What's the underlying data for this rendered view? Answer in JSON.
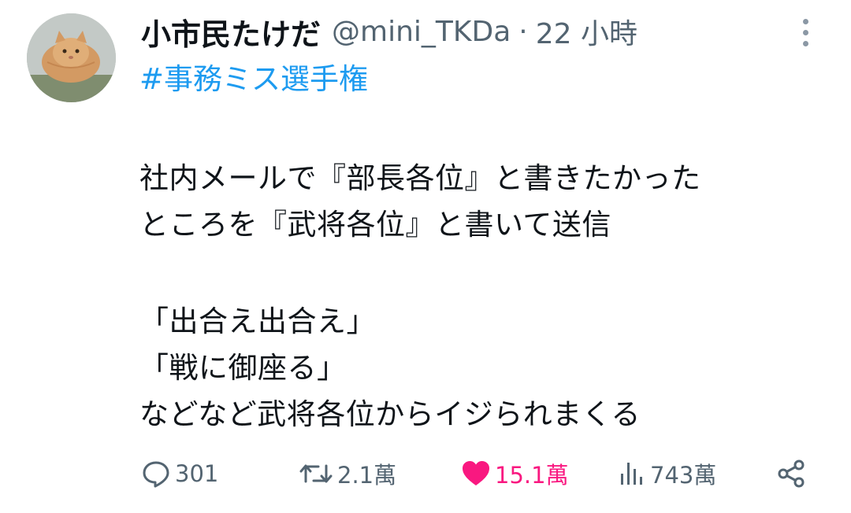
{
  "tweet": {
    "author": {
      "display_name": "小市民たけだ",
      "handle": "@mini_TKDa",
      "separator": "·",
      "time": "22 小時"
    },
    "hashtag": "#事務ミス選手権",
    "lines": [
      "社内メールで『部長各位』と書きたかった",
      "ところを『武将各位』と書いて送信",
      "「出合え出合え」",
      "「戦に御座る」",
      "などなど武将各位からイジられまくる"
    ],
    "actions": {
      "reply": {
        "icon": "reply-icon",
        "count": "301"
      },
      "retweet": {
        "icon": "retweet-icon",
        "count": "2.1萬"
      },
      "like": {
        "icon": "heart-icon",
        "count": "15.1萬",
        "liked": true
      },
      "views": {
        "icon": "views-icon",
        "count": "743萬"
      },
      "share": {
        "icon": "share-icon"
      }
    }
  },
  "colors": {
    "text": "#0f1419",
    "secondary": "#536471",
    "link": "#1d9bf0",
    "like": "#f91880"
  }
}
